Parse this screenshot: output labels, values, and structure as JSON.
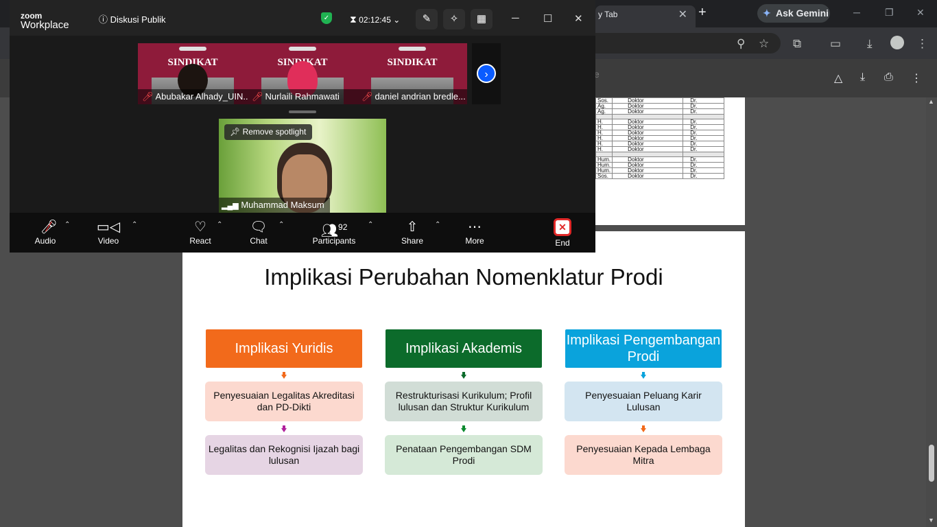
{
  "browser": {
    "tab_title": "y Tab",
    "tab_close": "✕",
    "new_tab": "+",
    "gemini_label": "Ask Gemini",
    "gemini_icon": "✦",
    "window_controls": [
      "─",
      "❐",
      "✕"
    ],
    "pdf_fragment": "e"
  },
  "doc_table": {
    "rows": [
      [
        "Sos.",
        "Doktor",
        "Dr."
      ],
      [
        "Ag.",
        "Doktor",
        "Dr."
      ],
      [
        "Ag.",
        "Doktor",
        "Dr."
      ],
      [
        "",
        "",
        ""
      ],
      [
        "H.",
        "Doktor",
        "Dr."
      ],
      [
        "H.",
        "Doktor",
        "Dr."
      ],
      [
        "H.",
        "Doktor",
        "Dr."
      ],
      [
        "H.",
        "Doktor",
        "Dr."
      ],
      [
        "H.",
        "Doktor",
        "Dr."
      ],
      [
        "H.",
        "Doktor",
        "Dr."
      ],
      [
        "",
        "",
        ""
      ],
      [
        "Hum.",
        "Doktor",
        "Dr."
      ],
      [
        "Hum.",
        "Doktor",
        "Dr."
      ],
      [
        "Hum.",
        "Doktor",
        "Dr."
      ],
      [
        "Sos.",
        "Doktor",
        "Dr."
      ]
    ]
  },
  "slide": {
    "title": "Implikasi Perubahan Nomenklatur Prodi",
    "columns": [
      {
        "header": "Implikasi Yuridis",
        "color": "#f26a1b",
        "items": [
          "Penyesuaian Legalitas Akreditasi dan PD-Dikti",
          "Legalitas dan Rekognisi Ijazah bagi lulusan"
        ]
      },
      {
        "header": "Implikasi Akademis",
        "color": "#0c6b2b",
        "items": [
          "Restrukturisasi Kurikulum; Profil lulusan dan Struktur Kurikulum",
          "Penataan Pengembangan SDM Prodi"
        ]
      },
      {
        "header": "Implikasi Pengembangan Prodi",
        "color": "#0aa3dc",
        "items": [
          "Penyesuaian Peluang Karir Lulusan",
          "Penyesuaian Kepada Lembaga Mitra"
        ]
      }
    ],
    "box_colors": [
      "#fcd9cf",
      "#d1ddd6",
      "#d3e5f1",
      "#e6d5e4",
      "#d5e9d7",
      "#fcd9cf"
    ],
    "arrow_colors": [
      "#f26a1b",
      "#0c6b2b",
      "#0aa3dc",
      "#b0209c",
      "#0c8a2f",
      "#f26a1b"
    ]
  },
  "zoom": {
    "logo_top": "zoom",
    "logo_bottom": "Workplace",
    "meeting_info_icon": "ⓘ",
    "meeting_name": "Diskusi Publik",
    "timer": "02:12:45",
    "participants": [
      {
        "name": "Abubakar Alhady_UIN...",
        "slide_word": "SINDIKAT"
      },
      {
        "name": "Nurlaili Rahmawati",
        "slide_word": "SINDIKAT"
      },
      {
        "name": "daniel andrian bredle...",
        "slide_word": "SINDIKAT"
      }
    ],
    "spotlight_label": "Remove spotlight",
    "spotlight_name": "Muhammad Maksum",
    "toolbar": {
      "audio": "Audio",
      "video": "Video",
      "react": "React",
      "chat": "Chat",
      "participants": "Participants",
      "participants_count": "92",
      "share": "Share",
      "more": "More",
      "end": "End"
    }
  }
}
